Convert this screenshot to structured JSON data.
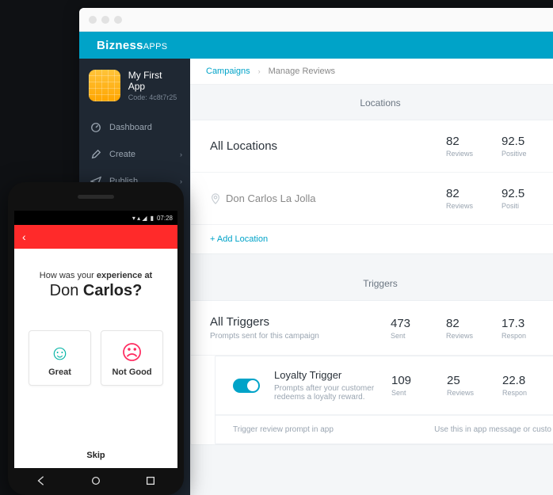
{
  "brand": {
    "name": "Bizness",
    "suffix": "APPS"
  },
  "app": {
    "name": "My First App",
    "code_label": "Code: 4c8t7r25"
  },
  "nav": {
    "items": [
      {
        "label": "Dashboard"
      },
      {
        "label": "Create"
      },
      {
        "label": "Publish"
      }
    ]
  },
  "breadcrumb": {
    "root": "Campaigns",
    "current": "Manage Reviews"
  },
  "locations": {
    "title": "Locations",
    "all_label": "All Locations",
    "all": {
      "reviews": "82",
      "reviews_label": "Reviews",
      "positive": "92.5",
      "positive_label": "Positive"
    },
    "items": [
      {
        "name": "Don Carlos La Jolla",
        "reviews": "82",
        "reviews_label": "Reviews",
        "positive": "92.5",
        "positive_label": "Positi"
      }
    ],
    "add_label": "+ Add Location"
  },
  "triggers": {
    "title": "Triggers",
    "all_label": "All Triggers",
    "all_sub": "Prompts sent for this campaign",
    "all": {
      "sent": "473",
      "sent_label": "Sent",
      "reviews": "82",
      "reviews_label": "Reviews",
      "resp": "17.3",
      "resp_label": "Respon"
    },
    "items": [
      {
        "name": "Loyalty Trigger",
        "desc": "Prompts after your customer redeems a loyalty reward.",
        "sent": "109",
        "sent_label": "Sent",
        "reviews": "25",
        "reviews_label": "Reviews",
        "resp": "22.8",
        "resp_label": "Respon"
      }
    ],
    "foot_left": "Trigger review prompt in app",
    "foot_right": "Use this in app message or custo"
  },
  "phone": {
    "time": "07:28",
    "prompt_prefix": "How was your ",
    "prompt_bold": "experience at",
    "location_light": "Don ",
    "location_bold": "Carlos?",
    "great": "Great",
    "notgood": "Not Good",
    "skip": "Skip"
  }
}
